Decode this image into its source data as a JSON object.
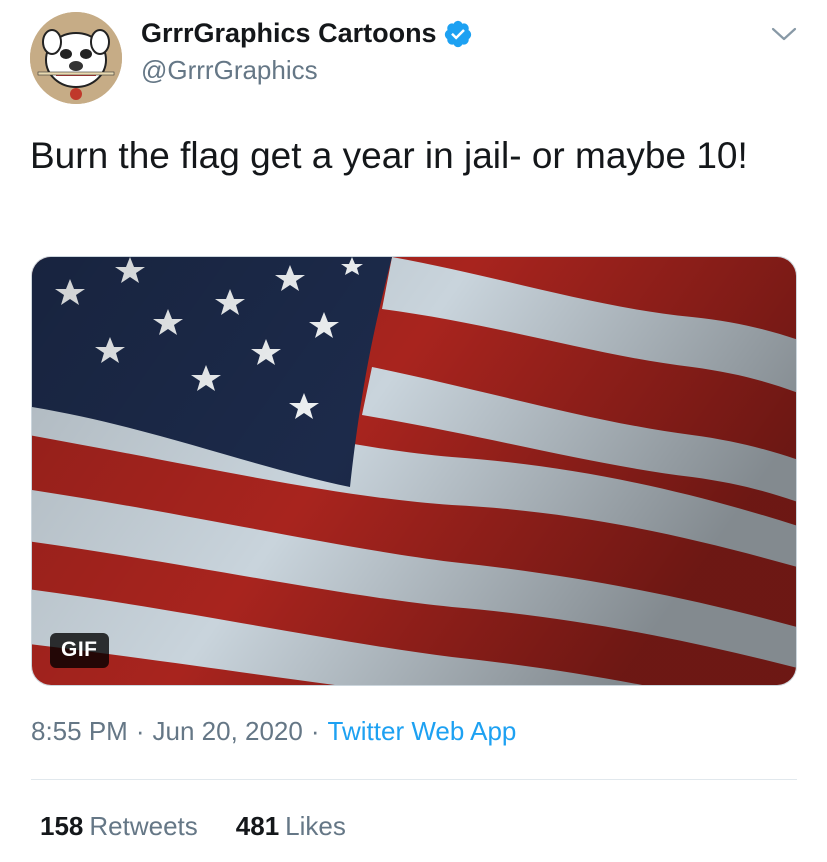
{
  "tweet": {
    "author": {
      "display_name": "GrrrGraphics Cartoons",
      "handle": "@GrrrGraphics",
      "verified": true,
      "avatar_icon": "bulldog-cartoon-avatar"
    },
    "text": "Burn the flag get a year in jail- or maybe 10!",
    "media": {
      "type": "gif",
      "badge": "GIF",
      "depicts": "waving-american-flag"
    },
    "time": "8:55 PM",
    "date": "Jun 20, 2020",
    "separator": "·",
    "source": "Twitter Web App",
    "stats": {
      "retweets_count": "158",
      "retweets_label": "Retweets",
      "likes_count": "481",
      "likes_label": "Likes"
    }
  },
  "colors": {
    "text_primary": "#14171a",
    "text_secondary": "#657786",
    "link": "#1da1f2",
    "verified_badge": "#1da1f2",
    "divider": "#e1e8ed",
    "flag_blue": "#1c2a4a",
    "flag_red": "#a8241e",
    "flag_white": "#c9d4dc"
  }
}
